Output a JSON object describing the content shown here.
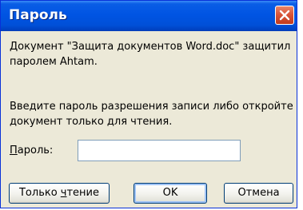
{
  "window": {
    "title": "Пароль"
  },
  "message": {
    "line1": "Документ \"Защита документов Word.doc\" защитил паролем Ahtam.",
    "line2": "Введите пароль разрешения записи либо откройте документ только для чтения."
  },
  "password": {
    "label_underlined": "П",
    "label_rest": "ароль:",
    "value": ""
  },
  "buttons": {
    "readonly_pre": "Только ",
    "readonly_underlined": "ч",
    "readonly_post": "тение",
    "ok": "OK",
    "cancel": "Отмена"
  },
  "colors": {
    "titlebar": "#0054e3",
    "close_button": "#d9553a",
    "dialog_background": "#ece9d8"
  },
  "icons": {
    "close": "close-icon"
  }
}
